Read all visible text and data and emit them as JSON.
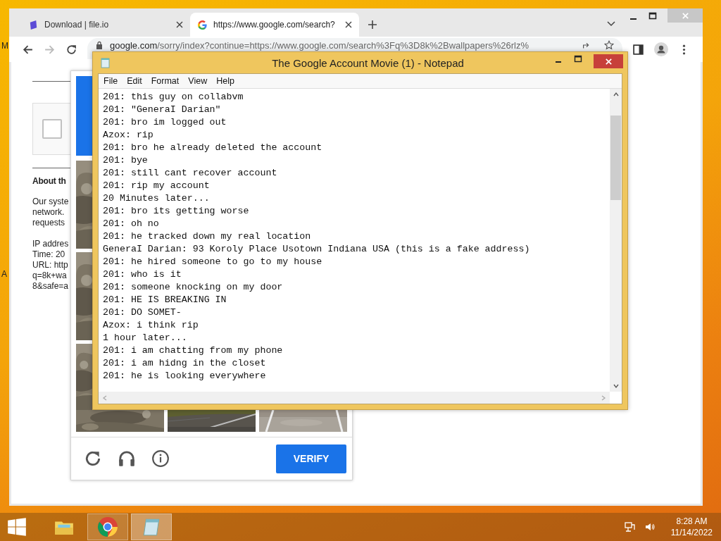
{
  "desktop": {
    "icon_labels": [
      "M",
      "A"
    ]
  },
  "browser": {
    "tabs": [
      {
        "title": "Download | file.io",
        "kind": "fileio",
        "selected": false
      },
      {
        "title": "https://www.google.com/search?",
        "kind": "google",
        "selected": true
      }
    ],
    "address_host": "google.com",
    "address_rest": "/sorry/index?continue=https://www.google.com/search%3Fq%3D8k%2Bwallpapers%26rlz%",
    "page": {
      "checkbox": {
        "checked": false
      },
      "heading": "About th",
      "paragraph": [
        "Our syste",
        "network.",
        "requests"
      ],
      "details": [
        "IP addres",
        "Time: 20",
        "URL: http",
        "q=8k+wa",
        "8&safe=a"
      ],
      "captcha": {
        "button": "VERIFY"
      }
    }
  },
  "notepad": {
    "title": "The Google Account Movie (1) - Notepad",
    "menu": [
      "File",
      "Edit",
      "Format",
      "View",
      "Help"
    ],
    "lines": [
      "201: this guy on collabvm",
      "201: \"GeneraI Darian\"",
      "201: bro im logged out",
      "Azox: rip",
      "201: bro he already deleted the account",
      "201: bye",
      "201: still cant recover account",
      "201: rip my account",
      "20 Minutes later...",
      "201: bro its getting worse",
      "201: oh no",
      "201: he tracked down my real location",
      "GeneraI Darian: 93 Koroly Place Usotown Indiana USA (this is a fake address)",
      "201: he hired someone to go to my house",
      "201: who is it",
      "201: someone knocking on my door",
      "201: HE IS BREAKING IN",
      "201: DO SOMET-",
      "Azox: i think rip",
      "1 hour later...",
      "201: i am chatting from my phone",
      "201: i am hidng in the closet",
      "201: he is looking everywhere"
    ]
  },
  "taskbar": {
    "apps": [
      {
        "kind": "explorer",
        "open": false,
        "selected": false
      },
      {
        "kind": "chrome",
        "open": true,
        "selected": false
      },
      {
        "kind": "notepad",
        "open": true,
        "selected": true
      }
    ],
    "time": "8:28 AM",
    "date": "11/14/2022"
  }
}
